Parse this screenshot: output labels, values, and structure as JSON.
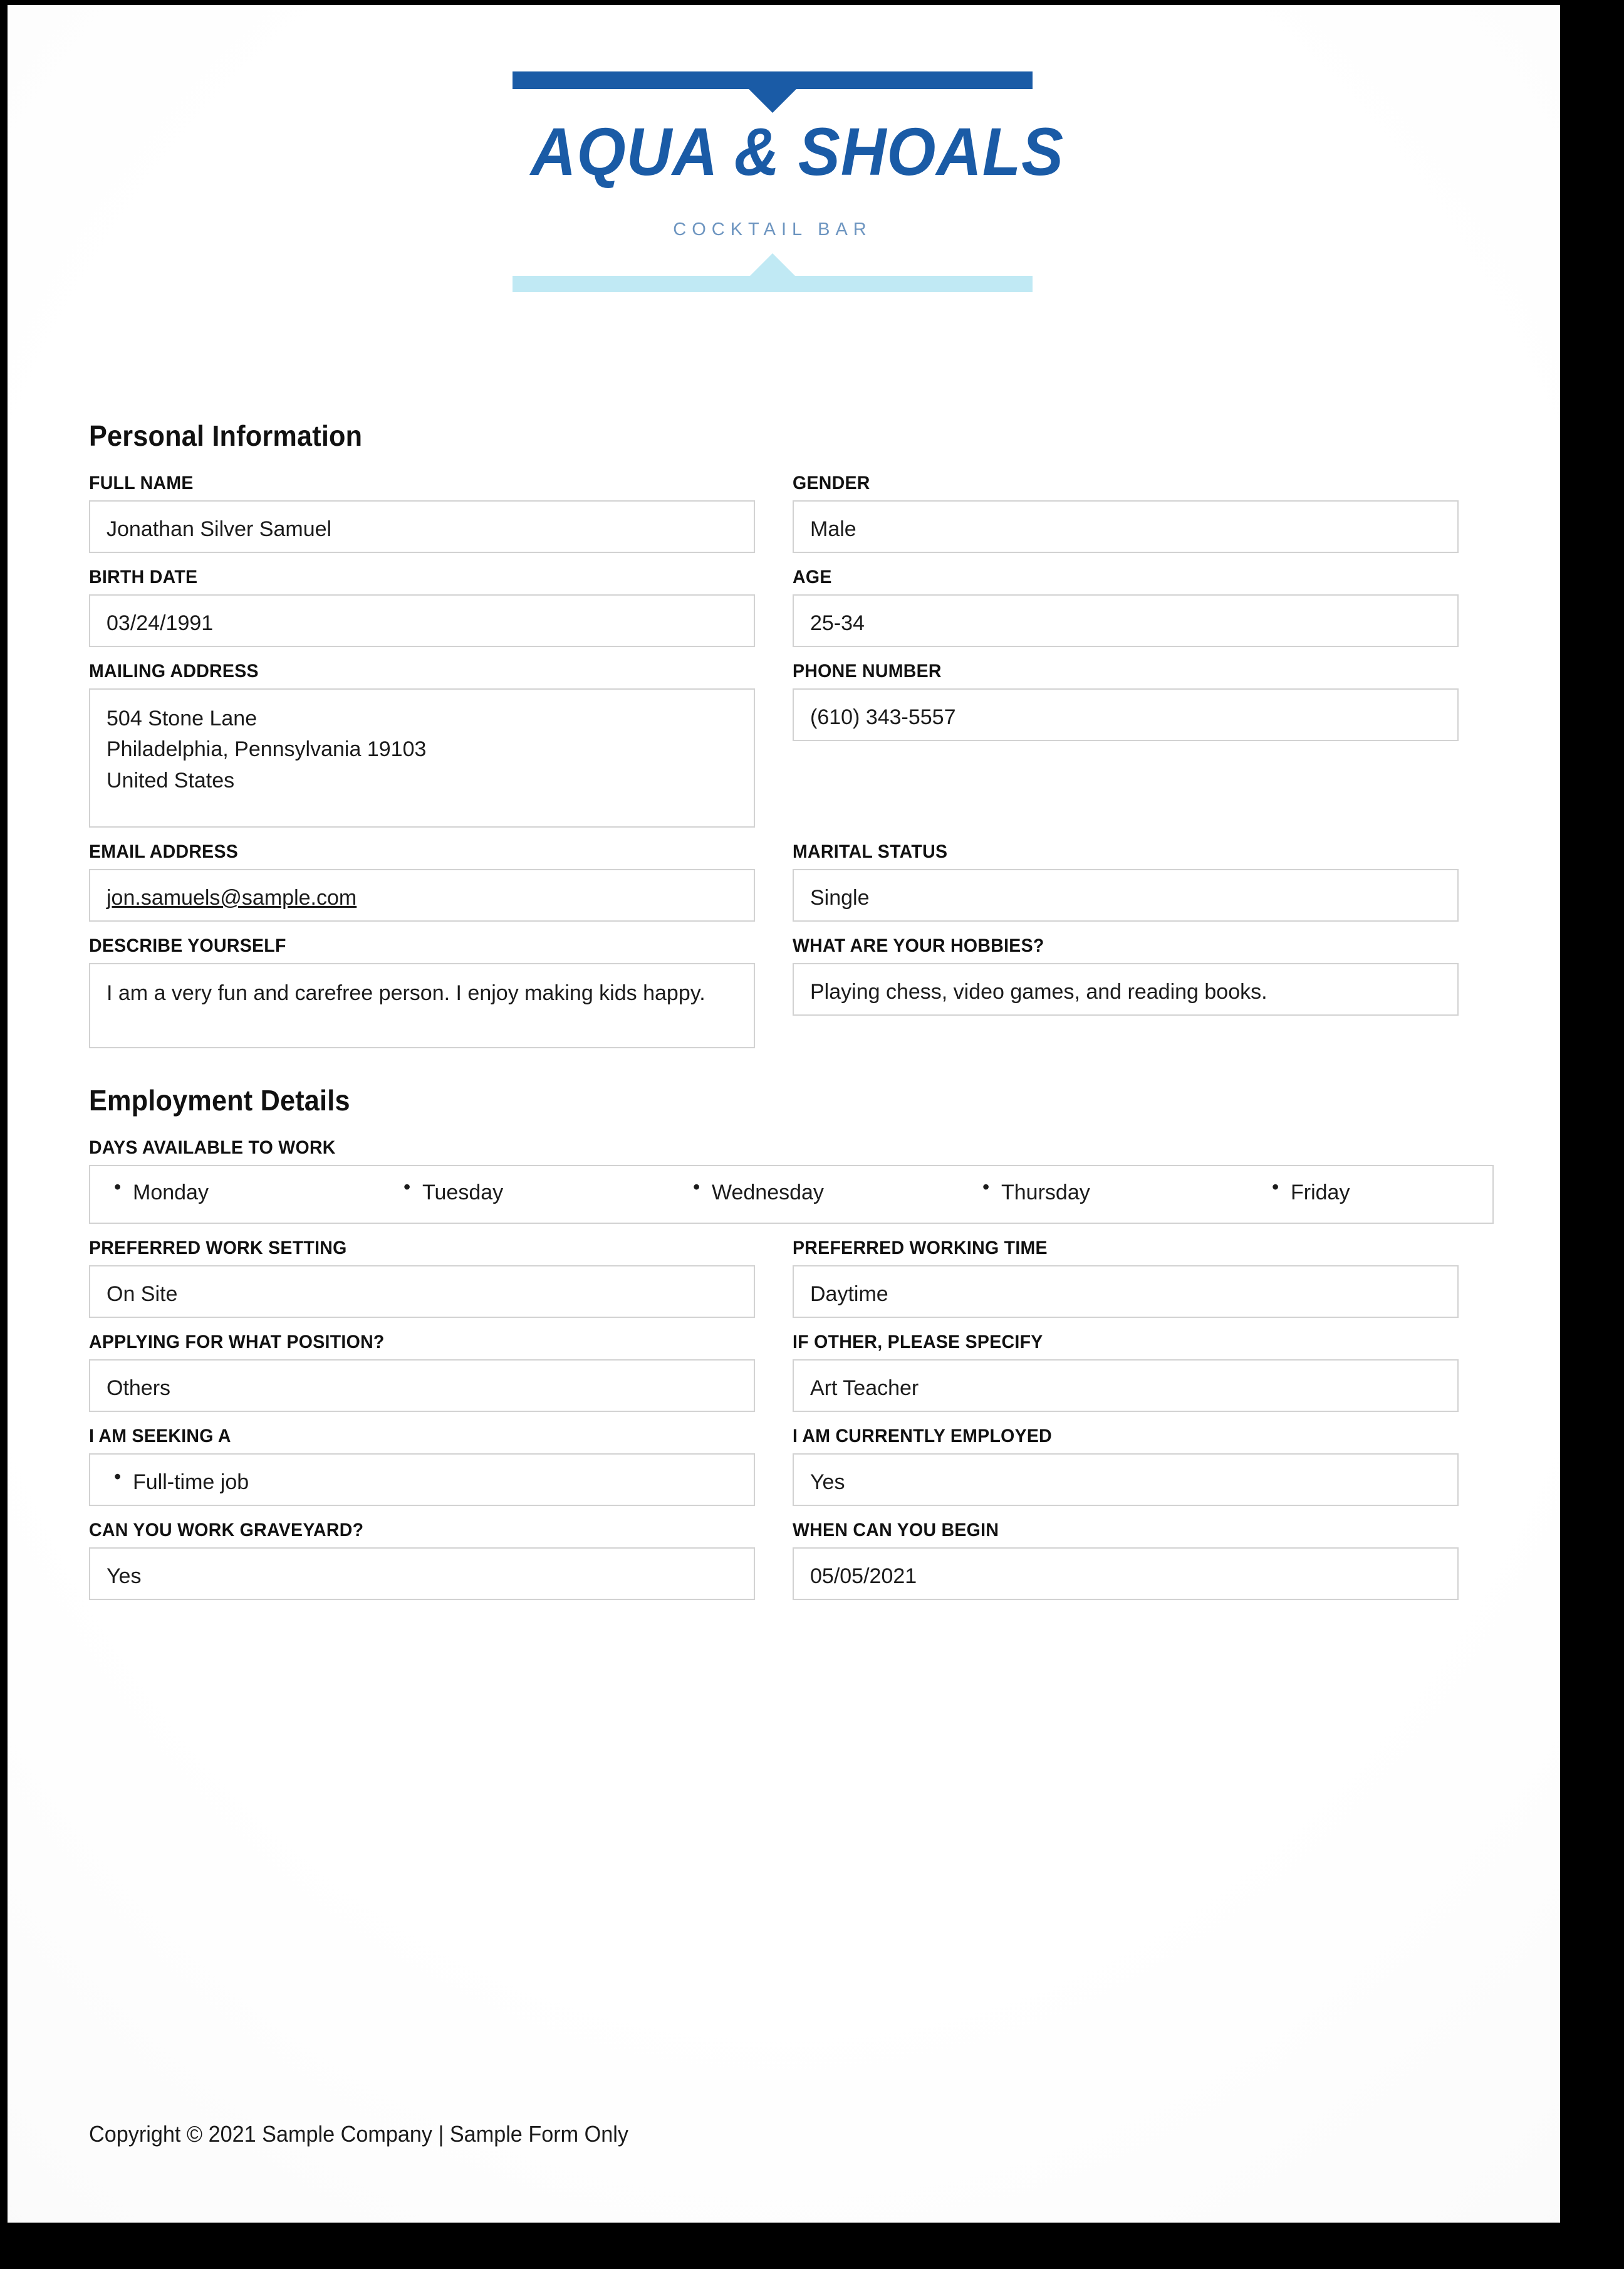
{
  "logo": {
    "name": "AQUA & SHOALS",
    "tagline": "COCKTAIL BAR",
    "colors": {
      "primary": "#1a5ba6",
      "accent_light": "#c0e9f4",
      "tagline_color": "#6d95c0"
    }
  },
  "sections": {
    "personal": {
      "title": "Personal Information",
      "fields": {
        "full_name": {
          "label": "FULL NAME",
          "value": "Jonathan Silver Samuel"
        },
        "gender": {
          "label": "GENDER",
          "value": "Male"
        },
        "birth_date": {
          "label": "BIRTH DATE",
          "value": "03/24/1991"
        },
        "age": {
          "label": "AGE",
          "value": "25-34"
        },
        "mailing_address": {
          "label": "MAILING ADDRESS",
          "lines": [
            "504 Stone Lane",
            "Philadelphia, Pennsylvania 19103",
            "United States"
          ],
          "line1": "504 Stone Lane",
          "line2": "Philadelphia, Pennsylvania 19103",
          "line3": "United States"
        },
        "phone_number": {
          "label": "PHONE NUMBER",
          "value": "(610) 343-5557"
        },
        "email_address": {
          "label": "EMAIL ADDRESS",
          "value": "jon.samuels@sample.com"
        },
        "marital_status": {
          "label": "MARITAL STATUS",
          "value": "Single"
        },
        "describe_yourself": {
          "label": "DESCRIBE YOURSELF",
          "value": "I am a very fun and carefree person. I enjoy making kids happy."
        },
        "hobbies": {
          "label": "WHAT ARE YOUR HOBBIES?",
          "value": "Playing chess, video games, and reading books."
        }
      }
    },
    "employment": {
      "title": "Employment Details",
      "fields": {
        "days_available": {
          "label": "DAYS AVAILABLE TO WORK",
          "items": [
            "Monday",
            "Tuesday",
            "Wednesday",
            "Thursday",
            "Friday"
          ],
          "item0": "Monday",
          "item1": "Tuesday",
          "item2": "Wednesday",
          "item3": "Thursday",
          "item4": "Friday"
        },
        "work_setting": {
          "label": "PREFERRED WORK SETTING",
          "value": "On Site"
        },
        "working_time": {
          "label": "PREFERRED WORKING TIME",
          "value": "Daytime"
        },
        "position": {
          "label": "APPLYING FOR WHAT POSITION?",
          "value": "Others"
        },
        "other_specify": {
          "label": "IF OTHER, PLEASE SPECIFY",
          "value": "Art Teacher"
        },
        "seeking": {
          "label": "I AM SEEKING A",
          "items": [
            "Full-time job"
          ],
          "item0": "Full-time job"
        },
        "currently_employed": {
          "label": "I AM CURRENTLY EMPLOYED",
          "value": "Yes"
        },
        "graveyard": {
          "label": "CAN YOU WORK GRAVEYARD?",
          "value": "Yes"
        },
        "begin_date": {
          "label": "WHEN CAN YOU BEGIN",
          "value": "05/05/2021"
        }
      }
    }
  },
  "footer": {
    "copyright": "Copyright © 2021 Sample Company | Sample Form Only"
  }
}
